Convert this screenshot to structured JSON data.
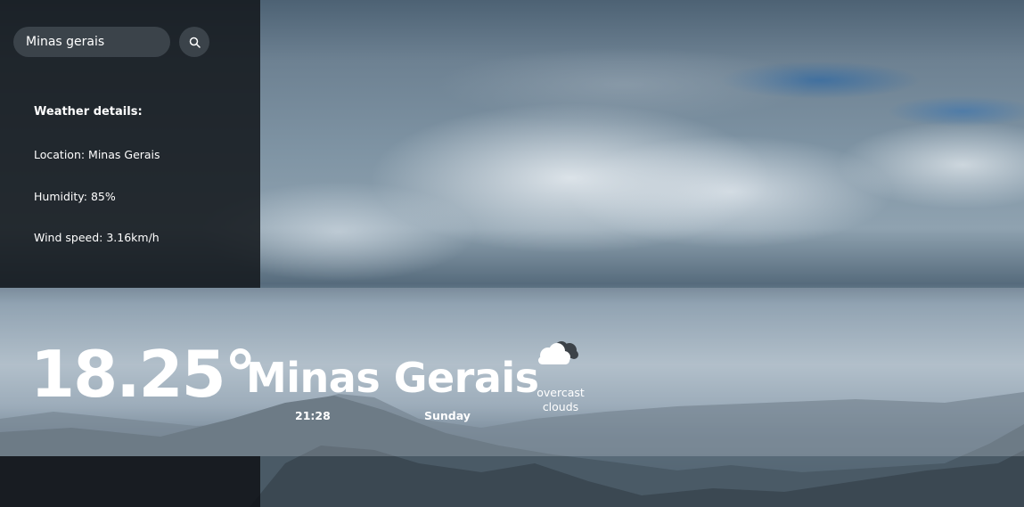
{
  "search": {
    "value": "Minas gerais",
    "button_icon": "search-icon"
  },
  "details": {
    "title": "Weather details:",
    "location": "Location: Minas Gerais",
    "humidity": "Humidity: 85%",
    "wind": "Wind speed: 3.16km/h"
  },
  "current": {
    "temperature": "18.25°",
    "city": "Minas Gerais",
    "time": "21:28",
    "day": "Sunday",
    "condition": "overcast clouds",
    "icon": "cloud-icon"
  }
}
